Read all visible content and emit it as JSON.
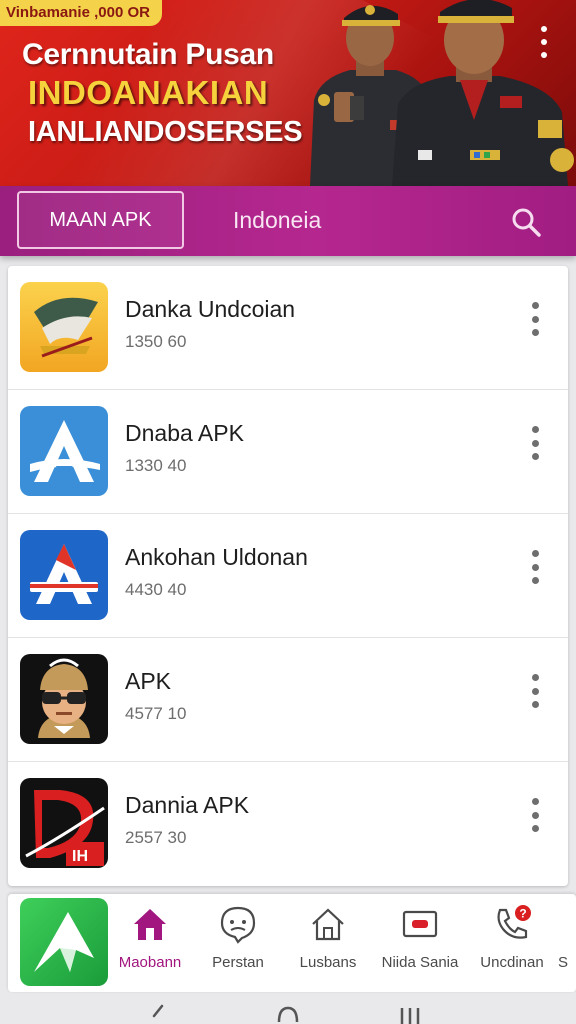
{
  "banner": {
    "badge": "Vinbamanie ,000 OR",
    "line1": "Cernnutain Pusan",
    "line2": "INDOANAKIAN",
    "line3": "IANLIANDOSERSES"
  },
  "toolbar": {
    "main_button": "MAAN APK",
    "country": "Indoneia"
  },
  "apps": [
    {
      "name": "Danka Undcoian",
      "meta": "1350 60",
      "icon": "gold-emblem-icon"
    },
    {
      "name": "Dnaba  APK",
      "meta": "1330 40",
      "icon": "letter-a-blue-icon"
    },
    {
      "name": "Ankohan  Uldonan",
      "meta": "4430 40",
      "icon": "letter-a-red-blue-icon"
    },
    {
      "name": "APK",
      "meta": "4577 10",
      "icon": "cartoon-face-icon"
    },
    {
      "name": "Dannia  APK",
      "meta": "2557 30",
      "icon": "red-swoosh-icon"
    }
  ],
  "bottom_nav": [
    {
      "label": "Maobann",
      "icon": "home-icon",
      "active": true
    },
    {
      "label": "Perstan",
      "icon": "face-icon",
      "active": false
    },
    {
      "label": "Lusbans",
      "icon": "house-outline-icon",
      "active": false
    },
    {
      "label": "Niida Sania",
      "icon": "card-icon",
      "active": false
    },
    {
      "label": "Uncdinan",
      "icon": "phone-icon",
      "active": false,
      "badge": "?"
    },
    {
      "label": "S",
      "icon": "",
      "active": false
    }
  ],
  "colors": {
    "banner_red": "#c41a14",
    "title_yellow": "#f6d33c",
    "purple": "#a11d82",
    "active_nav": "#a1167f"
  }
}
